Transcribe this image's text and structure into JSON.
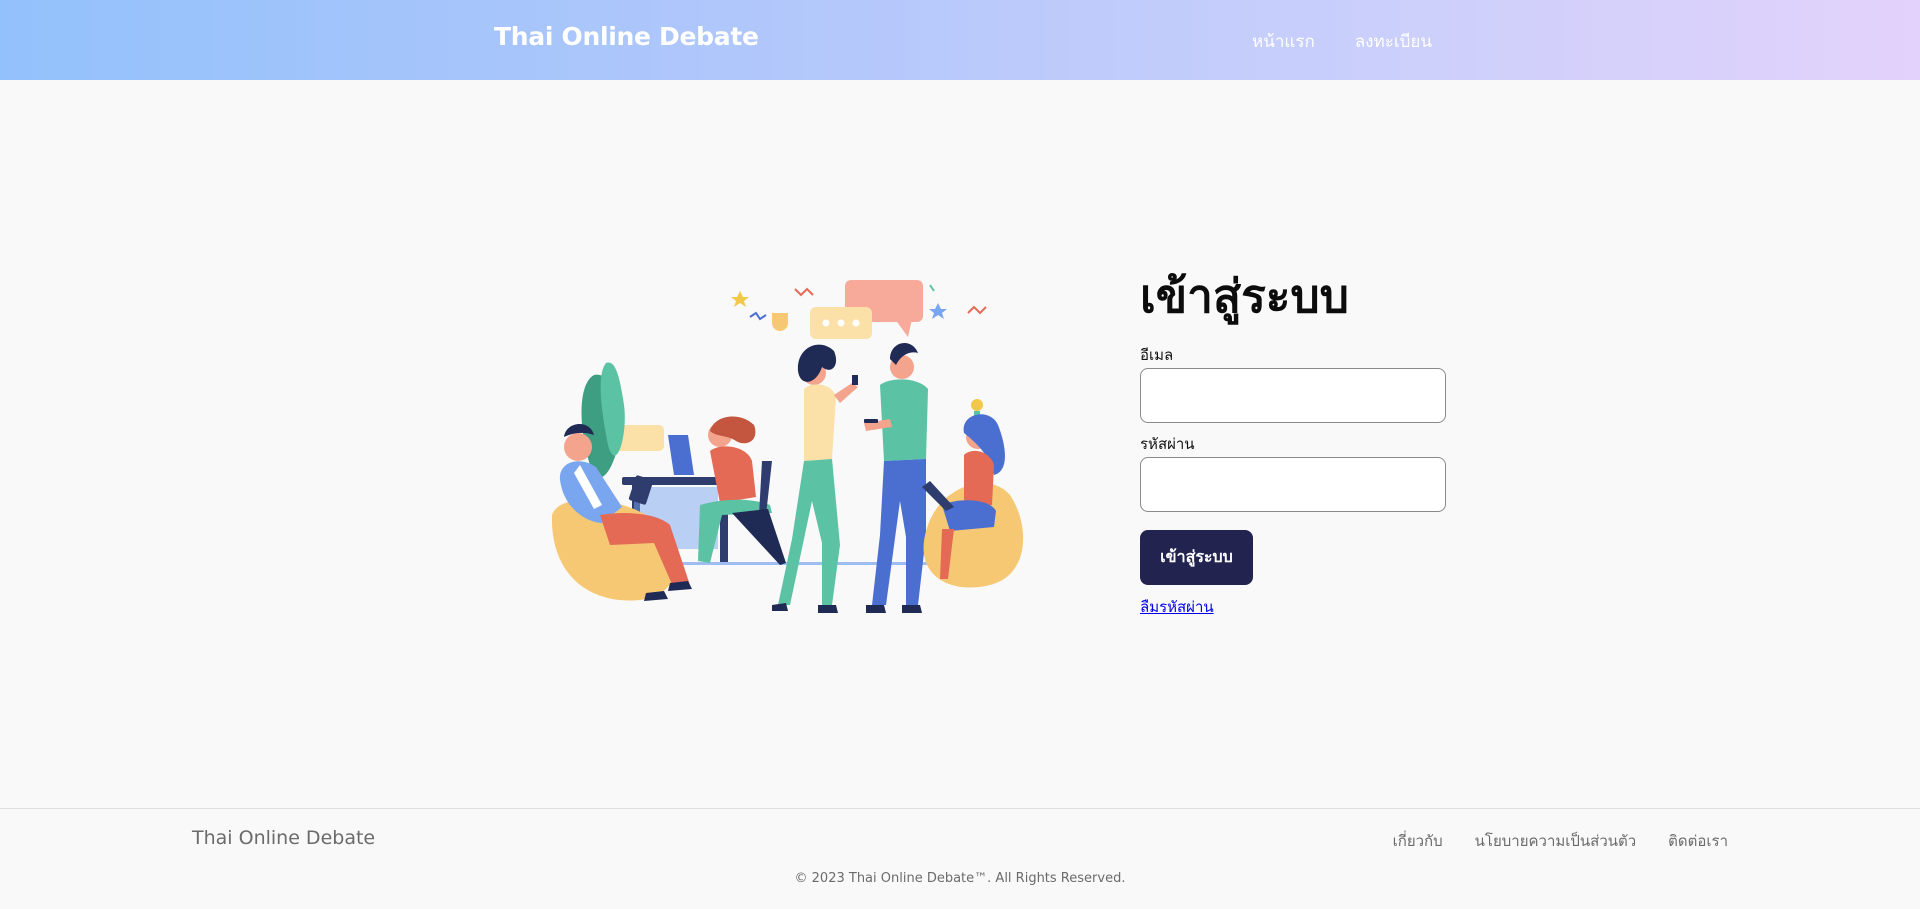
{
  "header": {
    "brand": "Thai Online Debate",
    "nav": [
      {
        "label": "หน้าแรก"
      },
      {
        "label": "ลงทะเบียน"
      }
    ],
    "gradient_colors": [
      "#93c1fb",
      "#e3d2fb"
    ]
  },
  "illustration": {
    "icon": "people-chatting-illustration"
  },
  "login": {
    "title": "เข้าสู่ระบบ",
    "email_label": "อีเมล",
    "email_value": "",
    "password_label": "รหัสผ่าน",
    "password_value": "",
    "submit_label": "เข้าสู่ระบบ",
    "forgot_label": "ลืมรหัสผ่าน",
    "button_color": "#22244f"
  },
  "footer": {
    "brand": "Thai Online Debate",
    "links": [
      {
        "label": "เกี่ยวกับ"
      },
      {
        "label": "นโยบายความเป็นส่วนตัว"
      },
      {
        "label": "ติดต่อเรา"
      }
    ],
    "copyright": "© 2023 Thai Online Debate™. All Rights Reserved."
  }
}
